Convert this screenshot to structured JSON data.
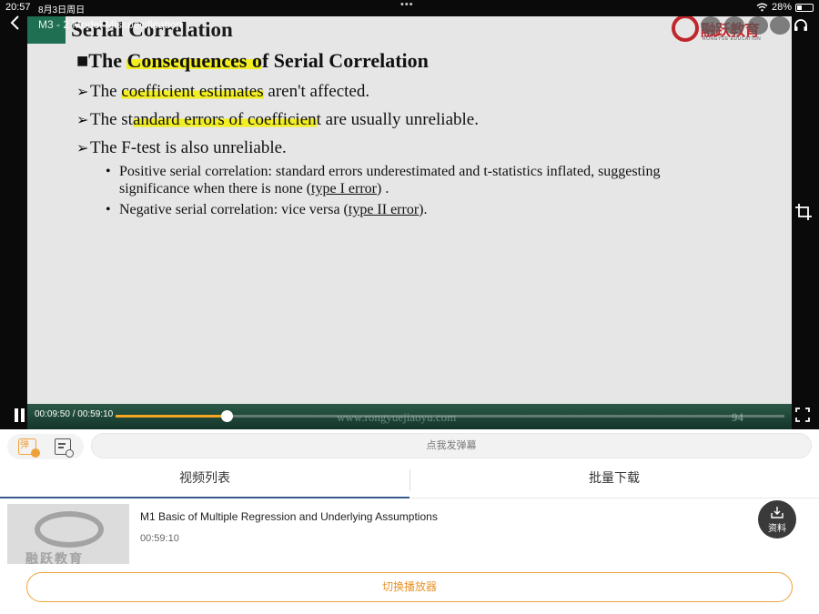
{
  "status_bar": {
    "time": "20:57",
    "date": "8月3日周日",
    "battery": "28%"
  },
  "video": {
    "title": "M3 - 2 Model Misspecification"
  },
  "slide": {
    "title": "Serial Correlation",
    "brand": "融跃教育",
    "brand_sub": "RONGYUE EDUCATION",
    "heading_pre": "■The ",
    "heading_hl": "Consequences o",
    "heading_post": "f Serial Correlation",
    "bullets": [
      {
        "pre": "The ",
        "hl": "coefficient estimates",
        "post": " aren't affected."
      },
      {
        "pre": "The st",
        "hl": "andard errors of coefficien",
        "post": "t are usually unreliable."
      },
      {
        "pre": "The F-test is also unreliable.",
        "hl": "",
        "post": ""
      }
    ],
    "sub_bullets": [
      {
        "text1": "Positive serial correlation: standard errors  underestimated and t-statistics inflated, suggesting  significance when there is none (",
        "link": "type I error",
        "text2": ") ."
      },
      {
        "text1": "Negative serial correlation: vice versa (",
        "link": "type II error",
        "text2": ")."
      }
    ],
    "footer_url": "www.rongyuejiaoyu.com",
    "page_number": "94"
  },
  "player": {
    "time_label": "00:09:50 / 00:59:10",
    "progress": 0.166
  },
  "danmaku": {
    "placeholder": "点我发弹幕",
    "toggle_label": "弹"
  },
  "tabs": [
    {
      "label": "视频列表"
    },
    {
      "label": "批量下载"
    }
  ],
  "list": {
    "items": [
      {
        "title": "M1 Basic of Multiple Regression and Underlying Assumptions",
        "duration": "00:59:10",
        "thumb_text": "融跃教育"
      }
    ],
    "materials_label": "资料"
  },
  "switch_player_label": "切换播放器",
  "colors": {
    "accent": "#f5a623",
    "highlight": "#f2ee22",
    "slide_green": "#1f6f53",
    "brand_red": "#c0272d"
  }
}
